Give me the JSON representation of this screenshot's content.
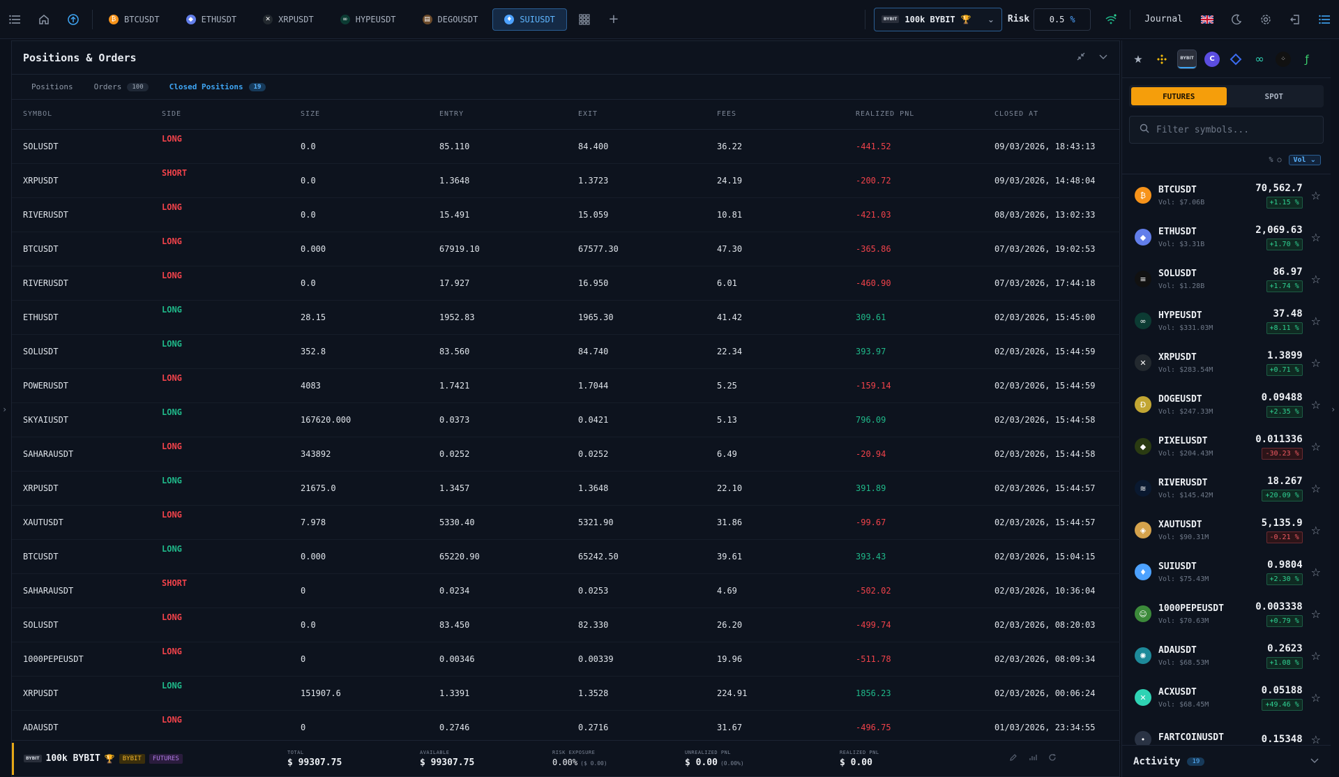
{
  "topbar": {
    "tabs": [
      {
        "label": "BTCUSDT",
        "icon": "bitcoin-icon",
        "color": "#f7931a",
        "glyph": "₿"
      },
      {
        "label": "ETHUSDT",
        "icon": "ethereum-icon",
        "color": "#627eea",
        "glyph": "◆"
      },
      {
        "label": "XRPUSDT",
        "icon": "xrp-icon",
        "color": "#23292f",
        "glyph": "✕"
      },
      {
        "label": "HYPEUSDT",
        "icon": "hype-icon",
        "color": "#0c3b33",
        "glyph": "∞"
      },
      {
        "label": "DEGOUSDT",
        "icon": "dego-icon",
        "color": "#6b4a2a",
        "glyph": "▤"
      },
      {
        "label": "SUIUSDT",
        "icon": "sui-icon",
        "color": "#4da2ff",
        "glyph": "♦",
        "active": true
      }
    ],
    "account_label": "100k BYBIT",
    "bybit_chip": "BYBIT",
    "risk_label": "Risk",
    "risk_value": "0.5",
    "risk_unit": "%",
    "journal_label": "Journal"
  },
  "panel": {
    "title": "Positions & Orders",
    "subtabs": {
      "positions": "Positions",
      "orders": "Orders",
      "orders_count": "100",
      "closed": "Closed Positions",
      "closed_count": "19"
    },
    "columns": [
      "SYMBOL",
      "SIDE",
      "SIZE",
      "ENTRY",
      "EXIT",
      "FEES",
      "REALIZED PNL",
      "CLOSED AT"
    ],
    "rows": [
      {
        "symbol": "SOLUSDT",
        "side": "LONG",
        "side_tone": "red",
        "size": "0.0",
        "entry": "85.110",
        "exit": "84.400",
        "fees": "36.22",
        "pnl": "-441.52",
        "pnl_tone": "neg",
        "closed": "09/03/2026, 18:43:13"
      },
      {
        "symbol": "XRPUSDT",
        "side": "SHORT",
        "side_tone": "red",
        "size": "0.0",
        "entry": "1.3648",
        "exit": "1.3723",
        "fees": "24.19",
        "pnl": "-200.72",
        "pnl_tone": "neg",
        "closed": "09/03/2026, 14:48:04"
      },
      {
        "symbol": "RIVERUSDT",
        "side": "LONG",
        "side_tone": "red",
        "size": "0.0",
        "entry": "15.491",
        "exit": "15.059",
        "fees": "10.81",
        "pnl": "-421.03",
        "pnl_tone": "neg",
        "closed": "08/03/2026, 13:02:33"
      },
      {
        "symbol": "BTCUSDT",
        "side": "LONG",
        "side_tone": "red",
        "size": "0.000",
        "entry": "67919.10",
        "exit": "67577.30",
        "fees": "47.30",
        "pnl": "-365.86",
        "pnl_tone": "neg",
        "closed": "07/03/2026, 19:02:53"
      },
      {
        "symbol": "RIVERUSDT",
        "side": "LONG",
        "side_tone": "red",
        "size": "0.0",
        "entry": "17.927",
        "exit": "16.950",
        "fees": "6.01",
        "pnl": "-460.90",
        "pnl_tone": "neg",
        "closed": "07/03/2026, 17:44:18"
      },
      {
        "symbol": "ETHUSDT",
        "side": "LONG",
        "side_tone": "green",
        "size": "28.15",
        "entry": "1952.83",
        "exit": "1965.30",
        "fees": "41.42",
        "pnl": "309.61",
        "pnl_tone": "pos",
        "closed": "02/03/2026, 15:45:00"
      },
      {
        "symbol": "SOLUSDT",
        "side": "LONG",
        "side_tone": "green",
        "size": "352.8",
        "entry": "83.560",
        "exit": "84.740",
        "fees": "22.34",
        "pnl": "393.97",
        "pnl_tone": "pos",
        "closed": "02/03/2026, 15:44:59"
      },
      {
        "symbol": "POWERUSDT",
        "side": "LONG",
        "side_tone": "red",
        "size": "4083",
        "entry": "1.7421",
        "exit": "1.7044",
        "fees": "5.25",
        "pnl": "-159.14",
        "pnl_tone": "neg",
        "closed": "02/03/2026, 15:44:59"
      },
      {
        "symbol": "SKYAIUSDT",
        "side": "LONG",
        "side_tone": "green",
        "size": "167620.000",
        "entry": "0.0373",
        "exit": "0.0421",
        "fees": "5.13",
        "pnl": "796.09",
        "pnl_tone": "pos",
        "closed": "02/03/2026, 15:44:58"
      },
      {
        "symbol": "SAHARAUSDT",
        "side": "LONG",
        "side_tone": "red",
        "size": "343892",
        "entry": "0.0252",
        "exit": "0.0252",
        "fees": "6.49",
        "pnl": "-20.94",
        "pnl_tone": "neg",
        "closed": "02/03/2026, 15:44:58"
      },
      {
        "symbol": "XRPUSDT",
        "side": "LONG",
        "side_tone": "green",
        "size": "21675.0",
        "entry": "1.3457",
        "exit": "1.3648",
        "fees": "22.10",
        "pnl": "391.89",
        "pnl_tone": "pos",
        "closed": "02/03/2026, 15:44:57"
      },
      {
        "symbol": "XAUTUSDT",
        "side": "LONG",
        "side_tone": "red",
        "size": "7.978",
        "entry": "5330.40",
        "exit": "5321.90",
        "fees": "31.86",
        "pnl": "-99.67",
        "pnl_tone": "neg",
        "closed": "02/03/2026, 15:44:57"
      },
      {
        "symbol": "BTCUSDT",
        "side": "LONG",
        "side_tone": "green",
        "size": "0.000",
        "entry": "65220.90",
        "exit": "65242.50",
        "fees": "39.61",
        "pnl": "393.43",
        "pnl_tone": "pos",
        "closed": "02/03/2026, 15:04:15"
      },
      {
        "symbol": "SAHARAUSDT",
        "side": "SHORT",
        "side_tone": "red",
        "size": "0",
        "entry": "0.0234",
        "exit": "0.0253",
        "fees": "4.69",
        "pnl": "-502.02",
        "pnl_tone": "neg",
        "closed": "02/03/2026, 10:36:04"
      },
      {
        "symbol": "SOLUSDT",
        "side": "LONG",
        "side_tone": "red",
        "size": "0.0",
        "entry": "83.450",
        "exit": "82.330",
        "fees": "26.20",
        "pnl": "-499.74",
        "pnl_tone": "neg",
        "closed": "02/03/2026, 08:20:03"
      },
      {
        "symbol": "1000PEPEUSDT",
        "side": "LONG",
        "side_tone": "red",
        "size": "0",
        "entry": "0.00346",
        "exit": "0.00339",
        "fees": "19.96",
        "pnl": "-511.78",
        "pnl_tone": "neg",
        "closed": "02/03/2026, 08:09:34"
      },
      {
        "symbol": "XRPUSDT",
        "side": "LONG",
        "side_tone": "green",
        "size": "151907.6",
        "entry": "1.3391",
        "exit": "1.3528",
        "fees": "224.91",
        "pnl": "1856.23",
        "pnl_tone": "pos",
        "closed": "02/03/2026, 00:06:24"
      },
      {
        "symbol": "ADAUSDT",
        "side": "LONG",
        "side_tone": "red",
        "size": "0",
        "entry": "0.2746",
        "exit": "0.2716",
        "fees": "31.67",
        "pnl": "-496.75",
        "pnl_tone": "neg",
        "closed": "01/03/2026, 23:34:55"
      }
    ]
  },
  "bottombar": {
    "account": "100k BYBIT",
    "exchange_pill": "BYBIT",
    "market_pill": "FUTURES",
    "total_label": "TOTAL",
    "total_value": "$ 99307.75",
    "available_label": "AVAILABLE",
    "available_value": "$ 99307.75",
    "risk_label": "RISK EXPOSURE",
    "risk_value": "0.00%",
    "risk_sub": "($ 0.00)",
    "unrealized_label": "UNREALIZED PNL",
    "unrealized_value": "$ 0.00",
    "unrealized_sub": "(0.00%)",
    "realized_label": "REALIZED PNL",
    "realized_value": "$ 0.00"
  },
  "sidebar": {
    "mode_futures": "FUTURES",
    "mode_spot": "SPOT",
    "filter_placeholder": "Filter symbols...",
    "sort_pct": "% ○",
    "sort_vol": "Vol",
    "symbols": [
      {
        "name": "BTCUSDT",
        "vol": "Vol: $7.06B",
        "price": "70,562.7",
        "chg": "+1.15 %",
        "dir": "up",
        "color": "#f7931a",
        "glyph": "₿"
      },
      {
        "name": "ETHUSDT",
        "vol": "Vol: $3.31B",
        "price": "2,069.63",
        "chg": "+1.70 %",
        "dir": "up",
        "color": "#627eea",
        "glyph": "◆"
      },
      {
        "name": "SOLUSDT",
        "vol": "Vol: $1.28B",
        "price": "86.97",
        "chg": "+1.74 %",
        "dir": "up",
        "color": "#111",
        "glyph": "≡"
      },
      {
        "name": "HYPEUSDT",
        "vol": "Vol: $331.03M",
        "price": "37.48",
        "chg": "+8.11 %",
        "dir": "up",
        "color": "#0c3b33",
        "glyph": "∞"
      },
      {
        "name": "XRPUSDT",
        "vol": "Vol: $283.54M",
        "price": "1.3899",
        "chg": "+0.71 %",
        "dir": "up",
        "color": "#23292f",
        "glyph": "✕"
      },
      {
        "name": "DOGEUSDT",
        "vol": "Vol: $247.33M",
        "price": "0.09488",
        "chg": "+2.35 %",
        "dir": "up",
        "color": "#c2a633",
        "glyph": "Ð"
      },
      {
        "name": "PIXELUSDT",
        "vol": "Vol: $204.43M",
        "price": "0.011336",
        "chg": "-30.23 %",
        "dir": "dn",
        "color": "#2a3b12",
        "glyph": "◆"
      },
      {
        "name": "RIVERUSDT",
        "vol": "Vol: $145.42M",
        "price": "18.267",
        "chg": "+20.09 %",
        "dir": "up",
        "color": "#0a1930",
        "glyph": "≋"
      },
      {
        "name": "XAUTUSDT",
        "vol": "Vol: $90.31M",
        "price": "5,135.9",
        "chg": "-0.21 %",
        "dir": "dn",
        "color": "#d4a24c",
        "glyph": "◈"
      },
      {
        "name": "SUIUSDT",
        "vol": "Vol: $75.43M",
        "price": "0.9804",
        "chg": "+2.30 %",
        "dir": "up",
        "color": "#4da2ff",
        "glyph": "♦"
      },
      {
        "name": "1000PEPEUSDT",
        "vol": "Vol: $70.63M",
        "price": "0.003338",
        "chg": "+0.79 %",
        "dir": "up",
        "color": "#3c8a3a",
        "glyph": "☺"
      },
      {
        "name": "ADAUSDT",
        "vol": "Vol: $68.53M",
        "price": "0.2623",
        "chg": "+1.08 %",
        "dir": "up",
        "color": "#1e8a9a",
        "glyph": "✺"
      },
      {
        "name": "ACXUSDT",
        "vol": "Vol: $68.45M",
        "price": "0.05188",
        "chg": "+49.46 %",
        "dir": "up",
        "color": "#2fd3b4",
        "glyph": "✕"
      },
      {
        "name": "FARTCOINUSDT",
        "vol": "",
        "price": "0.15348",
        "chg": "",
        "dir": "up",
        "color": "#2a3344",
        "glyph": "•"
      }
    ],
    "activity_label": "Activity",
    "activity_count": "19"
  }
}
